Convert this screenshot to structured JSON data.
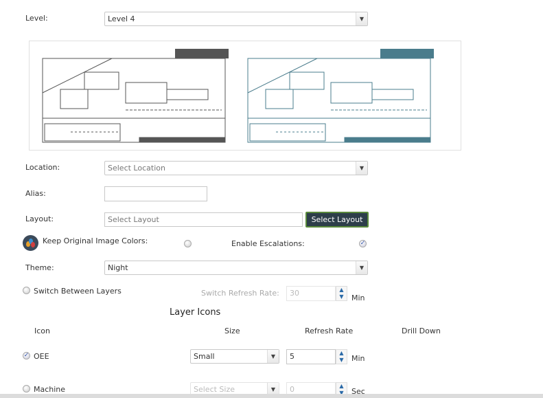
{
  "form": {
    "level": {
      "label": "Level:",
      "value": "Level 4"
    },
    "location": {
      "label": "Location:",
      "placeholder": "Select Location"
    },
    "alias": {
      "label": "Alias:",
      "value": ""
    },
    "layout": {
      "label": "Layout:",
      "placeholder": "Select Layout",
      "button": "Select Layout"
    },
    "keep_colors": {
      "label": "Keep Original Image Colors:",
      "checked": false
    },
    "escalations": {
      "label": "Enable Escalations:",
      "checked": true
    },
    "theme": {
      "label": "Theme:",
      "value": "Night"
    },
    "switch_layers": {
      "label": "Switch Between Layers",
      "checked": false
    },
    "switch_rate": {
      "label": "Switch Refresh Rate:",
      "value": "30",
      "unit": "Min"
    }
  },
  "preview": {
    "original_color": "#555555",
    "themed_color": "#4a7c8c"
  },
  "layer_icons": {
    "title": "Layer Icons",
    "headers": [
      "Icon",
      "Size",
      "Refresh Rate",
      "Drill Down"
    ],
    "rows": [
      {
        "name": "OEE",
        "checked": true,
        "size": "Small",
        "rate": "5",
        "unit": "Min"
      },
      {
        "name": "Machine",
        "checked": false,
        "size": "Select Size",
        "rate": "0",
        "unit": "Sec"
      }
    ]
  },
  "colors": {
    "button_bg": "#2d3e4a",
    "button_border": "#5a8a3c"
  }
}
